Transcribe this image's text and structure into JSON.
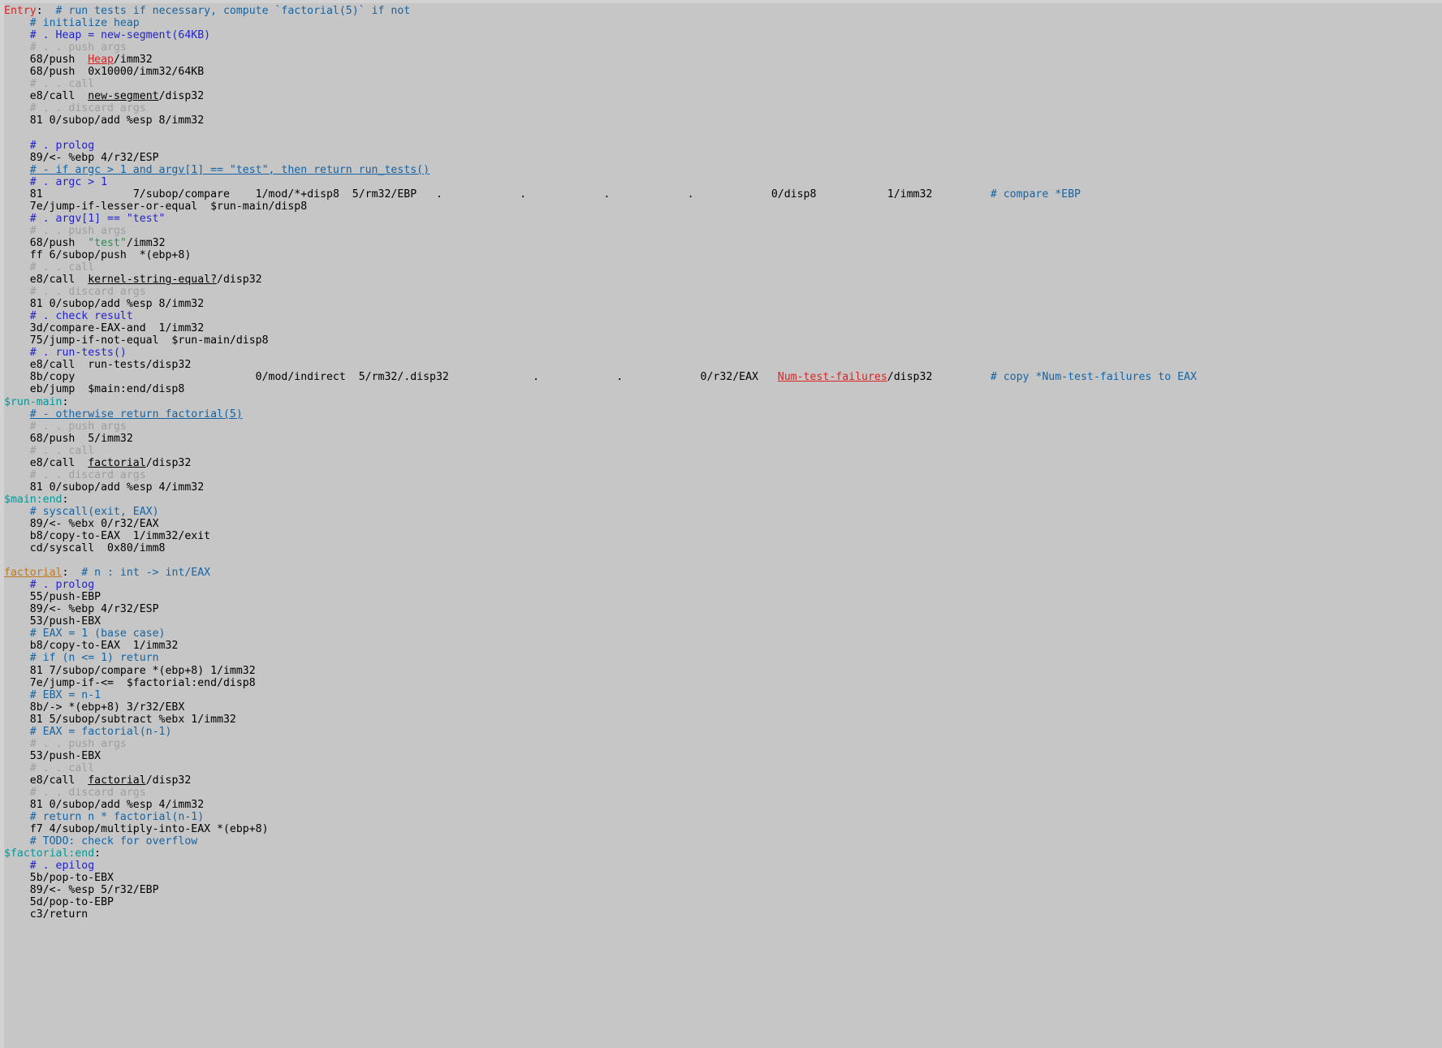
{
  "app": {
    "title": "mu assembly source",
    "background_color": "#c6c6c6",
    "font_size_px": 13.2,
    "line_height_px": 15.06
  },
  "palette": {
    "text": "#000000",
    "entry_label": "#dd2222",
    "local_label": "#009999",
    "function_def": "#c07820",
    "comment": "#1464a5",
    "comment_indigo": "#2222cc",
    "comment_faint": "#9e9e9e",
    "reference": "#000000",
    "reference_unresolved": "#dd2222",
    "string_literal": "#2e8b57",
    "background": "#c6c6c6"
  },
  "code": {
    "lines": [
      {
        "id": 1,
        "indent": 0,
        "tokens": [
          {
            "t": "Entry",
            "c": "entry"
          },
          {
            "t": ":  ",
            "c": "plain"
          },
          {
            "t": "# run tests if necessary, compute `factorial(5)` if not",
            "c": "comment"
          }
        ]
      },
      {
        "id": 2,
        "indent": 1,
        "tokens": [
          {
            "t": "# initialize heap",
            "c": "comment"
          }
        ]
      },
      {
        "id": 3,
        "indent": 1,
        "tokens": [
          {
            "t": "# . Heap = new-segment(64KB)",
            "c": "comment-hi"
          }
        ]
      },
      {
        "id": 4,
        "indent": 1,
        "tokens": [
          {
            "t": "# . . push args",
            "c": "faint"
          }
        ]
      },
      {
        "id": 5,
        "indent": 1,
        "tokens": [
          {
            "t": "68/push  ",
            "c": "plain"
          },
          {
            "t": "Heap",
            "c": "ref-red"
          },
          {
            "t": "/imm32",
            "c": "plain"
          }
        ]
      },
      {
        "id": 6,
        "indent": 1,
        "tokens": [
          {
            "t": "68/push  0x10000/imm32/64KB",
            "c": "plain"
          }
        ]
      },
      {
        "id": 7,
        "indent": 1,
        "tokens": [
          {
            "t": "# . . call",
            "c": "faint"
          }
        ]
      },
      {
        "id": 8,
        "indent": 1,
        "tokens": [
          {
            "t": "e8/call  ",
            "c": "plain"
          },
          {
            "t": "new-segment",
            "c": "ref"
          },
          {
            "t": "/disp32",
            "c": "plain"
          }
        ]
      },
      {
        "id": 9,
        "indent": 1,
        "tokens": [
          {
            "t": "# . . discard args",
            "c": "faint"
          }
        ]
      },
      {
        "id": 10,
        "indent": 1,
        "tokens": [
          {
            "t": "81 0/subop/add %esp 8/imm32",
            "c": "plain"
          }
        ]
      },
      {
        "id": 11,
        "indent": 0,
        "tokens": []
      },
      {
        "id": 12,
        "indent": 1,
        "tokens": [
          {
            "t": "# . prolog",
            "c": "comment-hi"
          }
        ]
      },
      {
        "id": 13,
        "indent": 1,
        "tokens": [
          {
            "t": "89/<- %ebp 4/r32/ESP",
            "c": "plain"
          }
        ]
      },
      {
        "id": 14,
        "indent": 1,
        "tokens": [
          {
            "t": "# - if argc > 1 and argv[1] == \"test\", then return run_tests()",
            "c": "comment-u"
          }
        ]
      },
      {
        "id": 15,
        "indent": 1,
        "tokens": [
          {
            "t": "# . argc > 1",
            "c": "comment-hi"
          }
        ]
      },
      {
        "id": 16,
        "indent": 1,
        "columns": [
          {
            "t": "81",
            "w": 16,
            "c": "plain"
          },
          {
            "t": "7/subop/compare",
            "w": 19,
            "c": "plain"
          },
          {
            "t": "1/mod/*+disp8",
            "w": 15,
            "c": "plain"
          },
          {
            "t": "5/rm32/EBP",
            "w": 13,
            "c": "plain"
          },
          {
            "t": ".",
            "w": 13,
            "c": "plain"
          },
          {
            "t": ".",
            "w": 13,
            "c": "plain"
          },
          {
            "t": ".",
            "w": 13,
            "c": "plain"
          },
          {
            "t": ".",
            "w": 13,
            "c": "plain"
          },
          {
            "t": "0/disp8",
            "w": 18,
            "c": "plain"
          },
          {
            "t": "1/imm32",
            "w": 16,
            "c": "plain"
          },
          {
            "t": "# compare *EBP",
            "w": 0,
            "c": "comment"
          }
        ]
      },
      {
        "id": 17,
        "indent": 1,
        "tokens": [
          {
            "t": "7e/jump-if-lesser-or-equal  $run-main/disp8",
            "c": "plain"
          }
        ]
      },
      {
        "id": 18,
        "indent": 1,
        "tokens": [
          {
            "t": "# . argv[1] == \"test\"",
            "c": "comment-hi"
          }
        ]
      },
      {
        "id": 19,
        "indent": 1,
        "tokens": [
          {
            "t": "# . . push args",
            "c": "faint"
          }
        ]
      },
      {
        "id": 20,
        "indent": 1,
        "tokens": [
          {
            "t": "68/push  ",
            "c": "plain"
          },
          {
            "t": "\"test\"",
            "c": "string"
          },
          {
            "t": "/imm32",
            "c": "plain"
          }
        ]
      },
      {
        "id": 21,
        "indent": 1,
        "tokens": [
          {
            "t": "ff 6/subop/push  *(ebp+8)",
            "c": "plain"
          }
        ]
      },
      {
        "id": 22,
        "indent": 1,
        "tokens": [
          {
            "t": "# . . call",
            "c": "faint"
          }
        ]
      },
      {
        "id": 23,
        "indent": 1,
        "tokens": [
          {
            "t": "e8/call  ",
            "c": "plain"
          },
          {
            "t": "kernel-string-equal?",
            "c": "ref"
          },
          {
            "t": "/disp32",
            "c": "plain"
          }
        ]
      },
      {
        "id": 24,
        "indent": 1,
        "tokens": [
          {
            "t": "# . . discard args",
            "c": "faint"
          }
        ]
      },
      {
        "id": 25,
        "indent": 1,
        "tokens": [
          {
            "t": "81 0/subop/add %esp 8/imm32",
            "c": "plain"
          }
        ]
      },
      {
        "id": 26,
        "indent": 1,
        "tokens": [
          {
            "t": "# . check result",
            "c": "comment-hi"
          }
        ]
      },
      {
        "id": 27,
        "indent": 1,
        "tokens": [
          {
            "t": "3d/compare-EAX-and  1/imm32",
            "c": "plain"
          }
        ]
      },
      {
        "id": 28,
        "indent": 1,
        "tokens": [
          {
            "t": "75/jump-if-not-equal  $run-main/disp8",
            "c": "plain"
          }
        ]
      },
      {
        "id": 29,
        "indent": 1,
        "tokens": [
          {
            "t": "# . run-tests()",
            "c": "comment-hi"
          }
        ]
      },
      {
        "id": 30,
        "indent": 1,
        "tokens": [
          {
            "t": "e8/call  run-tests/disp32",
            "c": "plain"
          }
        ]
      },
      {
        "id": 31,
        "indent": 1,
        "columns": [
          {
            "t": "8b/copy",
            "w": 35,
            "c": "plain"
          },
          {
            "t": "0/mod/indirect",
            "w": 16,
            "c": "plain"
          },
          {
            "t": "5/rm32/.disp32",
            "w": 27,
            "c": "plain"
          },
          {
            "t": ".",
            "w": 13,
            "c": "plain"
          },
          {
            "t": ".",
            "w": 13,
            "c": "plain"
          },
          {
            "t": "0/r32/EAX",
            "w": 12,
            "c": "plain"
          },
          {
            "t": "Num-test-failures",
            "w": 0,
            "c": "ref-red"
          },
          {
            "t": "/disp32",
            "w": 16,
            "c": "plain"
          },
          {
            "t": "# copy *Num-test-failures to EAX",
            "w": 0,
            "c": "comment"
          }
        ]
      },
      {
        "id": 32,
        "indent": 1,
        "tokens": [
          {
            "t": "eb/jump  $main:end/disp8",
            "c": "plain"
          }
        ]
      },
      {
        "id": 33,
        "indent": 0,
        "tokens": [
          {
            "t": "$run-main",
            "c": "label"
          },
          {
            "t": ":",
            "c": "plain"
          }
        ]
      },
      {
        "id": 34,
        "indent": 1,
        "tokens": [
          {
            "t": "# - otherwise return factorial(5)",
            "c": "comment-u"
          }
        ]
      },
      {
        "id": 35,
        "indent": 1,
        "tokens": [
          {
            "t": "# . . push args",
            "c": "faint"
          }
        ]
      },
      {
        "id": 36,
        "indent": 1,
        "tokens": [
          {
            "t": "68/push  5/imm32",
            "c": "plain"
          }
        ]
      },
      {
        "id": 37,
        "indent": 1,
        "tokens": [
          {
            "t": "# . . call",
            "c": "faint"
          }
        ]
      },
      {
        "id": 38,
        "indent": 1,
        "tokens": [
          {
            "t": "e8/call  ",
            "c": "plain"
          },
          {
            "t": "factorial",
            "c": "ref"
          },
          {
            "t": "/disp32",
            "c": "plain"
          }
        ]
      },
      {
        "id": 39,
        "indent": 1,
        "tokens": [
          {
            "t": "# . . discard args",
            "c": "faint"
          }
        ]
      },
      {
        "id": 40,
        "indent": 1,
        "tokens": [
          {
            "t": "81 0/subop/add %esp 4/imm32",
            "c": "plain"
          }
        ]
      },
      {
        "id": 41,
        "indent": 0,
        "tokens": [
          {
            "t": "$main:end",
            "c": "label"
          },
          {
            "t": ":",
            "c": "plain"
          }
        ]
      },
      {
        "id": 42,
        "indent": 1,
        "tokens": [
          {
            "t": "# syscall(exit, EAX)",
            "c": "comment"
          }
        ]
      },
      {
        "id": 43,
        "indent": 1,
        "tokens": [
          {
            "t": "89/<- %ebx 0/r32/EAX",
            "c": "plain"
          }
        ]
      },
      {
        "id": 44,
        "indent": 1,
        "tokens": [
          {
            "t": "b8/copy-to-EAX  1/imm32/exit",
            "c": "plain"
          }
        ]
      },
      {
        "id": 45,
        "indent": 1,
        "tokens": [
          {
            "t": "cd/syscall  0x80/imm8",
            "c": "plain"
          }
        ]
      },
      {
        "id": 46,
        "indent": 0,
        "tokens": []
      },
      {
        "id": 47,
        "indent": 0,
        "tokens": [
          {
            "t": "factorial",
            "c": "def"
          },
          {
            "t": ":  ",
            "c": "plain"
          },
          {
            "t": "# n : int -> int/EAX",
            "c": "comment"
          }
        ]
      },
      {
        "id": 48,
        "indent": 1,
        "tokens": [
          {
            "t": "# . prolog",
            "c": "comment-hi"
          }
        ]
      },
      {
        "id": 49,
        "indent": 1,
        "tokens": [
          {
            "t": "55/push-EBP",
            "c": "plain"
          }
        ]
      },
      {
        "id": 50,
        "indent": 1,
        "tokens": [
          {
            "t": "89/<- %ebp 4/r32/ESP",
            "c": "plain"
          }
        ]
      },
      {
        "id": 51,
        "indent": 1,
        "tokens": [
          {
            "t": "53/push-EBX",
            "c": "plain"
          }
        ]
      },
      {
        "id": 52,
        "indent": 1,
        "tokens": [
          {
            "t": "# EAX = 1 (base case)",
            "c": "comment"
          }
        ]
      },
      {
        "id": 53,
        "indent": 1,
        "tokens": [
          {
            "t": "b8/copy-to-EAX  1/imm32",
            "c": "plain"
          }
        ]
      },
      {
        "id": 54,
        "indent": 1,
        "tokens": [
          {
            "t": "# if (n <= 1) return",
            "c": "comment"
          }
        ]
      },
      {
        "id": 55,
        "indent": 1,
        "tokens": [
          {
            "t": "81 7/subop/compare *(ebp+8) 1/imm32",
            "c": "plain"
          }
        ]
      },
      {
        "id": 56,
        "indent": 1,
        "tokens": [
          {
            "t": "7e/jump-if-<=  $factorial:end/disp8",
            "c": "plain"
          }
        ]
      },
      {
        "id": 57,
        "indent": 1,
        "tokens": [
          {
            "t": "# EBX = n-1",
            "c": "comment"
          }
        ]
      },
      {
        "id": 58,
        "indent": 1,
        "tokens": [
          {
            "t": "8b/-> *(ebp+8) 3/r32/EBX",
            "c": "plain"
          }
        ]
      },
      {
        "id": 59,
        "indent": 1,
        "tokens": [
          {
            "t": "81 5/subop/subtract %ebx 1/imm32",
            "c": "plain"
          }
        ]
      },
      {
        "id": 60,
        "indent": 1,
        "tokens": [
          {
            "t": "# EAX = factorial(n-1)",
            "c": "comment"
          }
        ]
      },
      {
        "id": 61,
        "indent": 1,
        "tokens": [
          {
            "t": "# . . push args",
            "c": "faint"
          }
        ]
      },
      {
        "id": 62,
        "indent": 1,
        "tokens": [
          {
            "t": "53/push-EBX",
            "c": "plain"
          }
        ]
      },
      {
        "id": 63,
        "indent": 1,
        "tokens": [
          {
            "t": "# . . call",
            "c": "faint"
          }
        ]
      },
      {
        "id": 64,
        "indent": 1,
        "tokens": [
          {
            "t": "e8/call  ",
            "c": "plain"
          },
          {
            "t": "factorial",
            "c": "ref"
          },
          {
            "t": "/disp32",
            "c": "plain"
          }
        ]
      },
      {
        "id": 65,
        "indent": 1,
        "tokens": [
          {
            "t": "# . . discard args",
            "c": "faint"
          }
        ]
      },
      {
        "id": 66,
        "indent": 1,
        "tokens": [
          {
            "t": "81 0/subop/add %esp 4/imm32",
            "c": "plain"
          }
        ]
      },
      {
        "id": 67,
        "indent": 1,
        "tokens": [
          {
            "t": "# return n * factorial(n-1)",
            "c": "comment"
          }
        ]
      },
      {
        "id": 68,
        "indent": 1,
        "tokens": [
          {
            "t": "f7 4/subop/multiply-into-EAX *(ebp+8)",
            "c": "plain"
          }
        ]
      },
      {
        "id": 69,
        "indent": 1,
        "tokens": [
          {
            "t": "# TODO: check for overflow",
            "c": "comment"
          }
        ]
      },
      {
        "id": 70,
        "indent": 0,
        "tokens": [
          {
            "t": "$factorial:end",
            "c": "label"
          },
          {
            "t": ":",
            "c": "plain"
          }
        ]
      },
      {
        "id": 71,
        "indent": 1,
        "tokens": [
          {
            "t": "# . epilog",
            "c": "comment-hi"
          }
        ]
      },
      {
        "id": 72,
        "indent": 1,
        "tokens": [
          {
            "t": "5b/pop-to-EBX",
            "c": "plain"
          }
        ]
      },
      {
        "id": 73,
        "indent": 1,
        "tokens": [
          {
            "t": "89/<- %esp 5/r32/EBP",
            "c": "plain"
          }
        ]
      },
      {
        "id": 74,
        "indent": 1,
        "tokens": [
          {
            "t": "5d/pop-to-EBP",
            "c": "plain"
          }
        ]
      },
      {
        "id": 75,
        "indent": 1,
        "tokens": [
          {
            "t": "c3/return",
            "c": "plain"
          }
        ]
      }
    ]
  }
}
